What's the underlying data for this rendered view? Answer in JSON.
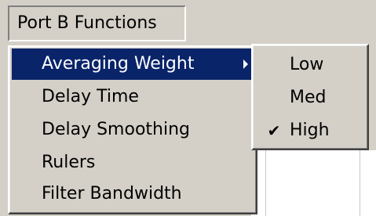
{
  "menubar": {
    "title": "Port B Functions"
  },
  "menu": {
    "items": [
      {
        "label": "Averaging Weight",
        "has_submenu": true,
        "highlighted": true
      },
      {
        "label": "Delay Time"
      },
      {
        "label": "Delay Smoothing"
      },
      {
        "label": "Rulers"
      },
      {
        "label": "Filter Bandwidth"
      }
    ]
  },
  "submenu": {
    "items": [
      {
        "label": "Low",
        "checked": false
      },
      {
        "label": "Med",
        "checked": false
      },
      {
        "label": "High",
        "checked": true,
        "check_glyph": "✔"
      }
    ]
  },
  "colors": {
    "face": "#d4d0c8",
    "highlight": "#0a246a",
    "highlight_text": "#ffffff"
  }
}
